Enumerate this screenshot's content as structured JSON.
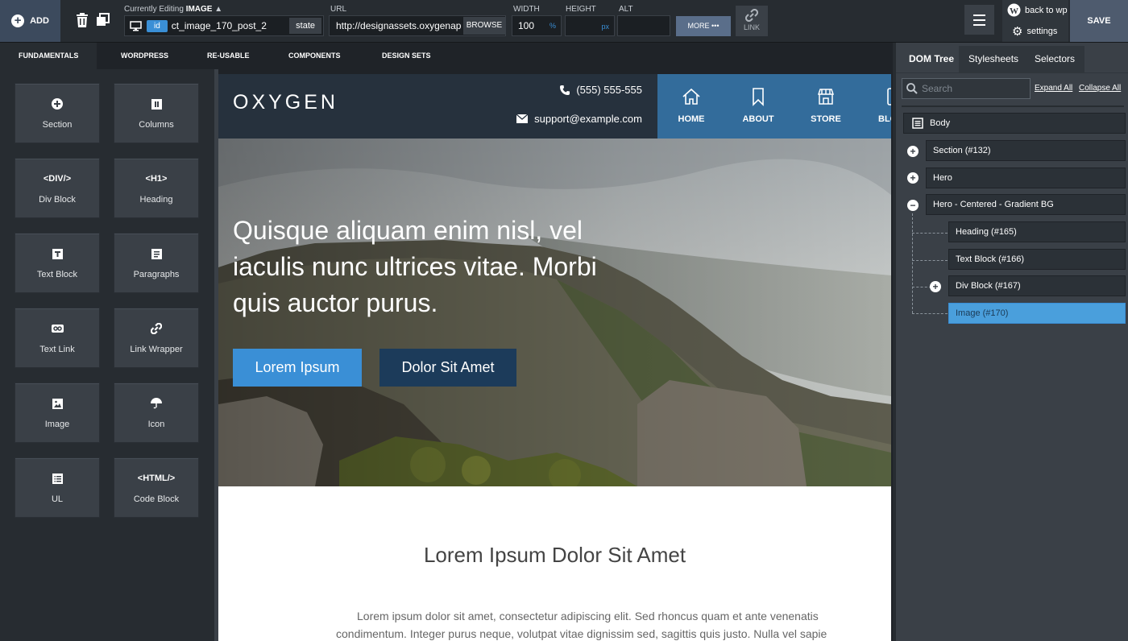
{
  "toolbar": {
    "add_label": "ADD",
    "editing_prefix": "Currently Editing",
    "editing_type": "IMAGE",
    "id_badge": "id",
    "selector_name": "ct_image_170_post_2",
    "state_label": "state",
    "url_label": "URL",
    "url_value": "http://designassets.oxygenap",
    "browse_label": "BROWSE",
    "width_label": "WIDTH",
    "width_value": "100",
    "width_unit": "%",
    "height_label": "HEIGHT",
    "height_unit": "px",
    "alt_label": "ALT",
    "more_label": "MORE",
    "link_label": "LINK",
    "back_label": "back to wp",
    "settings_label": "settings",
    "save_label": "SAVE"
  },
  "left_tabs": [
    "FUNDAMENTALS",
    "WORDPRESS",
    "RE-USABLE",
    "COMPONENTS",
    "DESIGN SETS"
  ],
  "tiles": [
    {
      "label": "Section",
      "icon": "plus-circle-icon"
    },
    {
      "label": "Columns",
      "icon": "columns-icon"
    },
    {
      "label": "Div Block",
      "icon": "div-tag-icon",
      "glyph": "<DIV/>"
    },
    {
      "label": "Heading",
      "icon": "h1-tag-icon",
      "glyph": "<H1>"
    },
    {
      "label": "Text Block",
      "icon": "text-icon"
    },
    {
      "label": "Paragraphs",
      "icon": "paragraph-icon"
    },
    {
      "label": "Text Link",
      "icon": "link-icon"
    },
    {
      "label": "Link Wrapper",
      "icon": "chain-icon"
    },
    {
      "label": "Image",
      "icon": "image-icon"
    },
    {
      "label": "Icon",
      "icon": "umbrella-icon"
    },
    {
      "label": "UL",
      "icon": "list-icon"
    },
    {
      "label": "Code Block",
      "icon": "html-tag-icon",
      "glyph": "<HTML/>"
    }
  ],
  "site": {
    "logo": "OXYGEN",
    "phone": "(555) 555-555",
    "email": "support@example.com",
    "nav": [
      {
        "label": "HOME",
        "icon": "home-icon"
      },
      {
        "label": "ABOUT",
        "icon": "bookmark-icon"
      },
      {
        "label": "STORE",
        "icon": "store-icon"
      },
      {
        "label": "BLOG",
        "icon": "device-icon"
      }
    ],
    "hero_title": "Quisque aliquam enim nisl, vel iaculis nunc ultrices vitae. Morbi quis auctor purus.",
    "hero_btn_primary": "Lorem Ipsum",
    "hero_btn_secondary": "Dolor Sit Amet",
    "section_title": "Lorem Ipsum Dolor Sit Amet",
    "section_line1": "Lorem ipsum dolor sit amet, consectetur adipiscing elit. Sed rhoncus quam et ante venenatis",
    "section_line2": "condimentum. Integer purus neque, volutpat vitae dignissim sed, sagittis quis justo. Nulla vel sapie"
  },
  "right_panel": {
    "tabs": [
      "DOM Tree",
      "Stylesheets",
      "Selectors"
    ],
    "search_placeholder": "Search",
    "expand_all": "Expand All",
    "collapse_all": "Collapse All",
    "tree": [
      {
        "label": "Body",
        "toggle": "none"
      },
      {
        "label": "Section (#132)",
        "toggle": "plus"
      },
      {
        "label": "Hero",
        "toggle": "plus"
      },
      {
        "label": "Hero - Centered - Gradient BG",
        "toggle": "minus"
      },
      {
        "label": "Heading (#165)",
        "toggle": "none"
      },
      {
        "label": "Text Block (#166)",
        "toggle": "none"
      },
      {
        "label": "Div Block (#167)",
        "toggle": "plus"
      },
      {
        "label": "Image (#170)",
        "toggle": "none",
        "selected": true
      }
    ]
  },
  "colors": {
    "accent": "#3a8fd6",
    "nav_blue": "#336c9b",
    "header_dark": "#26313d",
    "btn_primary": "#3a8fd6",
    "btn_secondary": "#1c3b5a",
    "selected_node": "#4a9fdc"
  }
}
